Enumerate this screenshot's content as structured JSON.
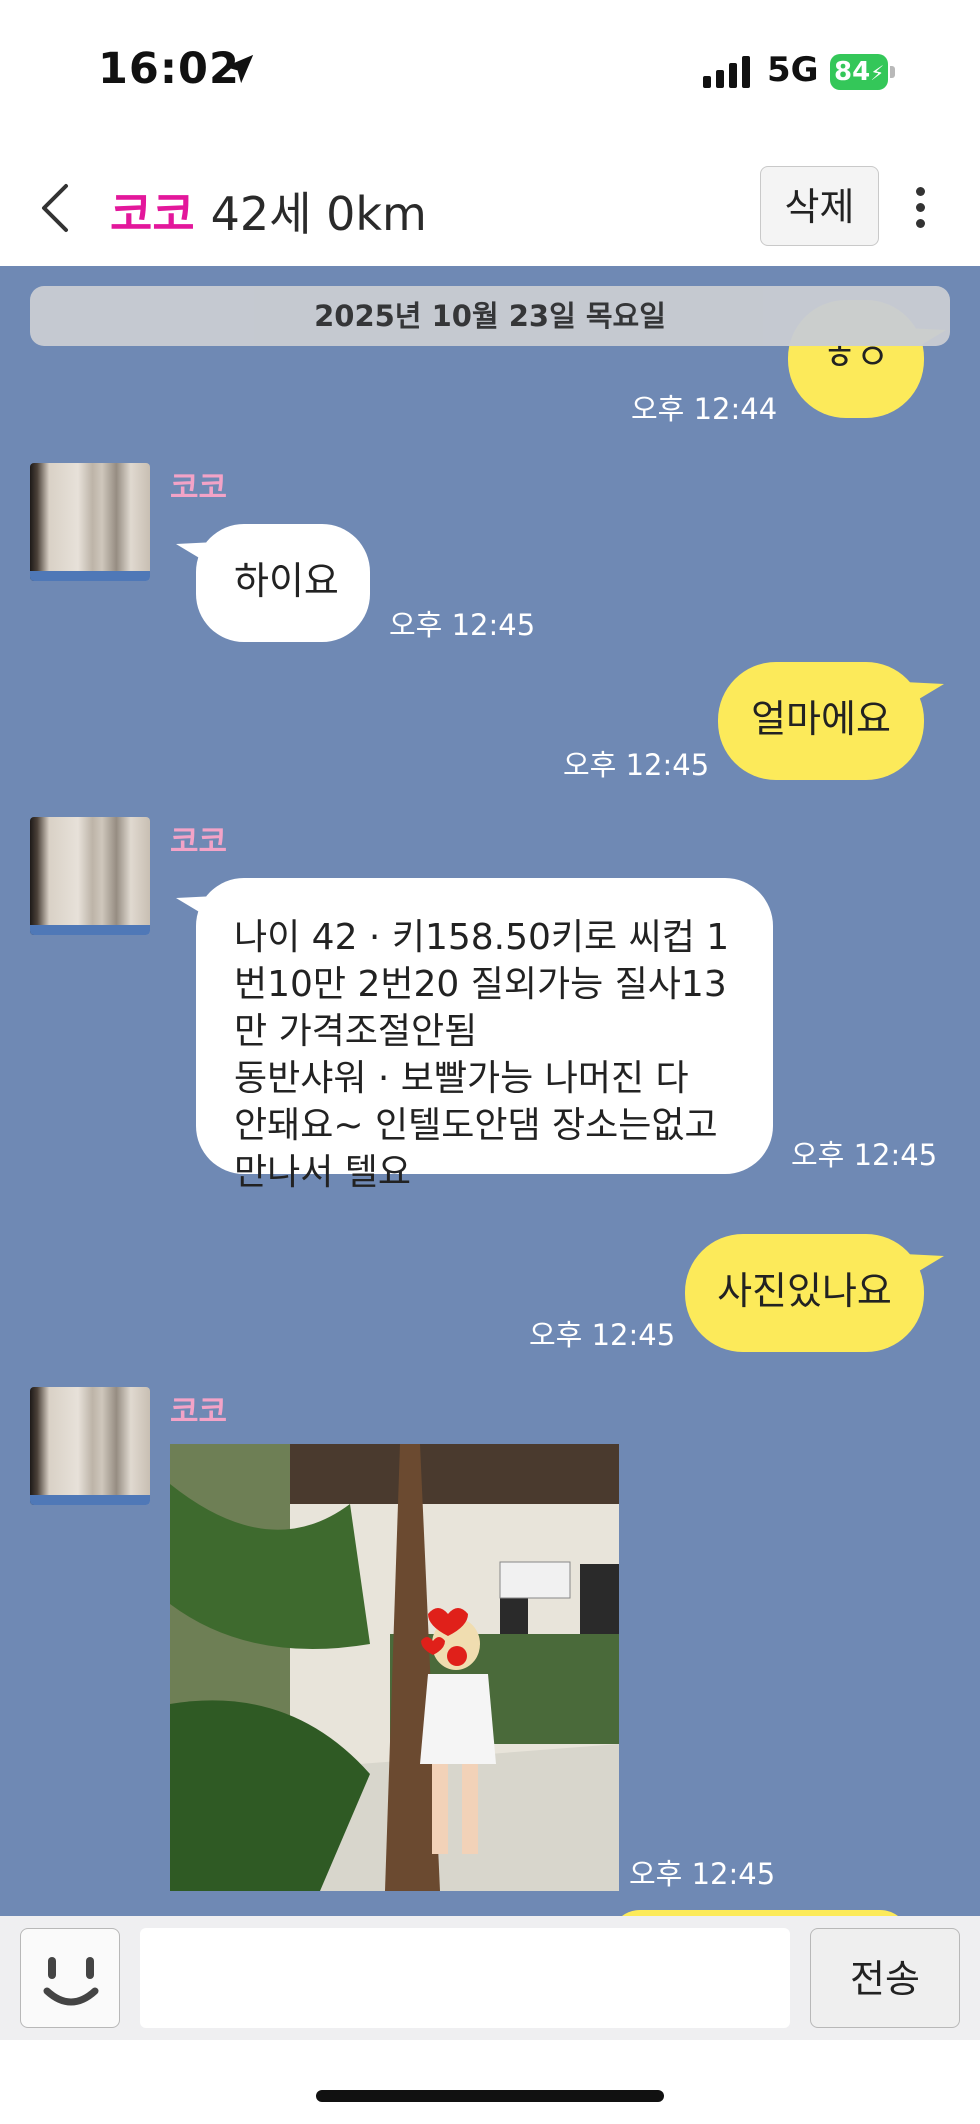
{
  "status_bar": {
    "time": "16:02",
    "network": "5G",
    "battery": "84"
  },
  "header": {
    "name": "코코",
    "subtitle": "42세 0km",
    "delete_label": "삭제"
  },
  "chat": {
    "date": "2025년 10월 23일 목요일",
    "sender_name": "코코",
    "messages": [
      {
        "from": "me",
        "text": "ㅎㅇ",
        "time": "오후 12:44"
      },
      {
        "from": "them",
        "text": "하이요",
        "time": "오후 12:45"
      },
      {
        "from": "me",
        "text": "얼마에요",
        "time": "오후 12:45"
      },
      {
        "from": "them",
        "lines": [
          "나이 42 · 키158.50키로 씨컵  1",
          "번10만 2번20 질외가능 질사13",
          "만 가격조절안됨",
          "동반샤워 · 보빨가능 나머진 다",
          "안돼요~ 인텔도안댐 장소는없고",
          "만나서 텔요"
        ],
        "time": "오후 12:45"
      },
      {
        "from": "me",
        "text": "사진있나요",
        "time": "오후 12:45"
      },
      {
        "from": "them",
        "type": "photo",
        "time": "오후 12:45"
      }
    ]
  },
  "input_bar": {
    "placeholder": "",
    "send_label": "전송"
  },
  "colors": {
    "chat_bg": "#6f89b4",
    "my_bubble": "#fcea5a",
    "their_bubble": "#ffffff",
    "name_accent": "#e3179b",
    "sender_name": "#f3a3c7"
  }
}
